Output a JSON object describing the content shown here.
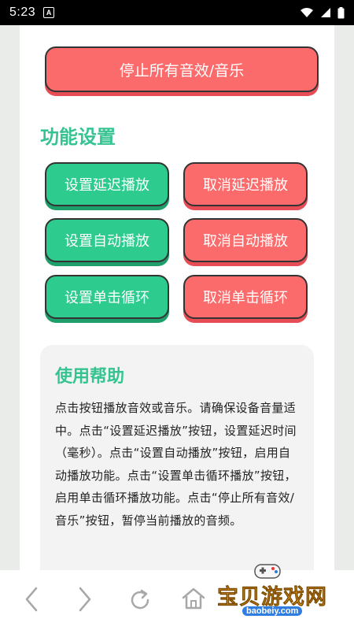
{
  "status_bar": {
    "time": "5:23",
    "notification_glyph": "A"
  },
  "controls": {
    "stop_all_label": "停止所有音效/音乐"
  },
  "function_settings": {
    "title": "功能设置",
    "set_delay_label": "设置延迟播放",
    "cancel_delay_label": "取消延迟播放",
    "set_auto_label": "设置自动播放",
    "cancel_auto_label": "取消自动播放",
    "set_loop_label": "设置单击循环",
    "cancel_loop_label": "取消单击循环"
  },
  "help": {
    "title": "使用帮助",
    "text": "点击按钮播放音效或音乐。请确保设备音量适中。点击“设置延迟播放”按钮，设置延迟时间（毫秒）。点击“设置自动播放”按钮，启用自动播放功能。点击“设置单击循环播放”按钮，启用单击循环播放功能。点击“停止所有音效/音乐”按钮，暂停当前播放的音频。"
  },
  "watermark": {
    "brand": "宝贝游戏网",
    "url": "baobeiy.com"
  },
  "colors": {
    "accent_green": "#2dcb8e",
    "title_green": "#35c491",
    "button_red": "#fb6b6b"
  },
  "icons": {
    "nav_back": "chevron-left-icon",
    "nav_forward": "chevron-right-icon",
    "nav_refresh": "refresh-icon",
    "nav_home": "home-icon"
  }
}
